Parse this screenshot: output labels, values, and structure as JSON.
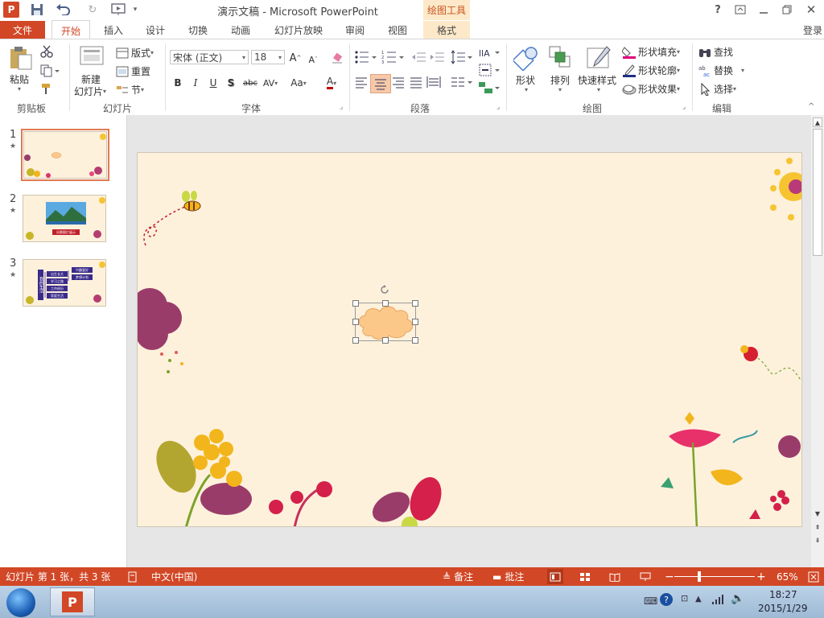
{
  "titlebar": {
    "doc_title": "演示文稿 - Microsoft PowerPoint",
    "context_tab": "绘图工具",
    "help": "?",
    "app_icon_letter": "P"
  },
  "tabs": {
    "file": "文件",
    "items": [
      "开始",
      "插入",
      "设计",
      "切换",
      "动画",
      "幻灯片放映",
      "审阅",
      "视图",
      "格式"
    ],
    "login": "登录"
  },
  "ribbon": {
    "clipboard": {
      "paste": "粘贴",
      "label": "剪贴板"
    },
    "slides": {
      "new_slide_line1": "新建",
      "new_slide_line2": "幻灯片",
      "layout": "版式",
      "reset": "重置",
      "section": "节",
      "label": "幻灯片"
    },
    "font": {
      "font_name": "宋体 (正文)",
      "font_size": "18",
      "bold": "B",
      "italic": "I",
      "underline": "U",
      "shadow": "S",
      "strike": "abc",
      "spacing": "AV",
      "case": "Aa",
      "color_a": "A",
      "label": "字体"
    },
    "paragraph": {
      "label": "段落"
    },
    "drawing": {
      "shapes": "形状",
      "arrange": "排列",
      "quick_styles": "快速样式",
      "fill": "形状填充",
      "outline": "形状轮廓",
      "effects": "形状效果",
      "label": "绘图"
    },
    "editing": {
      "find": "查找",
      "replace": "替换",
      "select": "选择",
      "label": "编辑"
    }
  },
  "thumbnails": [
    {
      "number": "1",
      "star": "★"
    },
    {
      "number": "2",
      "star": "★",
      "caption": "风景图片展示"
    },
    {
      "number": "3",
      "star": "★",
      "left_label": "我的生活",
      "items": [
        "出生长大",
        "学习之路",
        "工作经历",
        "家庭生活"
      ],
      "right_items": [
        "兴趣爱好",
        "梦想计划"
      ]
    }
  ],
  "status": {
    "slide_info": "幻灯片 第 1 张，共 3 张",
    "language": "中文(中国)",
    "notes": "备注",
    "comments": "批注",
    "zoom": "65%",
    "zoom_level": 0.65
  },
  "taskbar": {
    "time": "18:27",
    "date": "2015/1/29"
  },
  "colors": {
    "accent": "#d24726",
    "slide_bg": "#fdf1dc",
    "context_tab_bg": "#fde9c9",
    "selected_shape_fill": "#fcc88a"
  }
}
